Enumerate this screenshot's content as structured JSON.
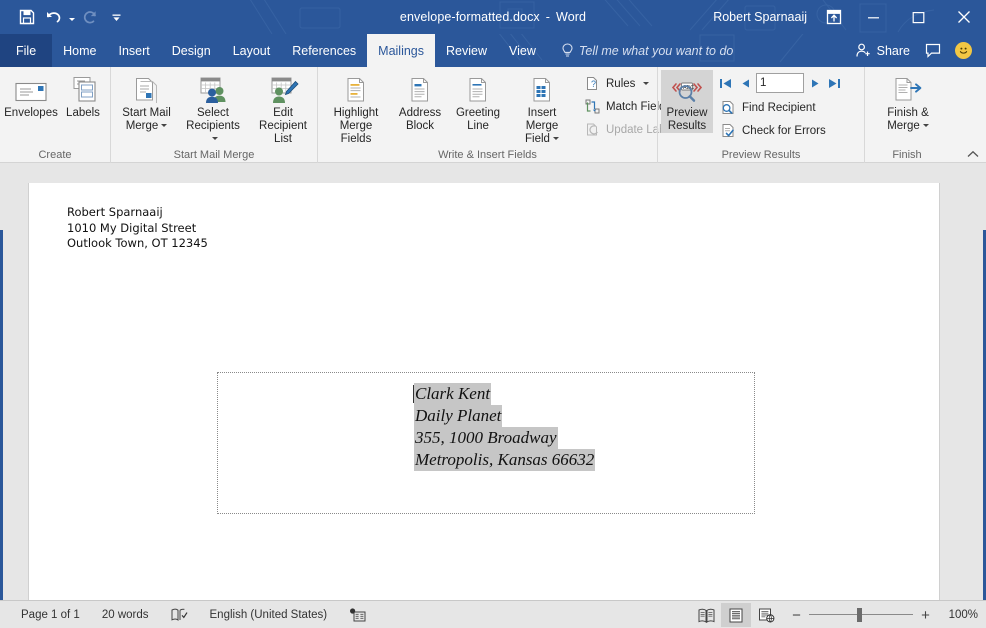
{
  "window": {
    "title": "envelope-formatted.docx",
    "title_separator": "-",
    "app_name": "Word",
    "account_name": "Robert Sparnaaij",
    "minimize_label": "Minimize",
    "maximize_label": "Maximize",
    "close_label": "Close",
    "ribbon_display_label": "Ribbon Display Options",
    "accent_color": "#2b579a"
  },
  "quick_access": [
    {
      "name": "save",
      "label": "Save"
    },
    {
      "name": "undo",
      "label": "Undo"
    },
    {
      "name": "redo",
      "label": "Repeat"
    },
    {
      "name": "customize",
      "label": "Customize Quick Access Toolbar"
    }
  ],
  "tabs": [
    {
      "label": "File",
      "active": false
    },
    {
      "label": "Home",
      "active": false
    },
    {
      "label": "Insert",
      "active": false
    },
    {
      "label": "Design",
      "active": false
    },
    {
      "label": "Layout",
      "active": false
    },
    {
      "label": "References",
      "active": false
    },
    {
      "label": "Mailings",
      "active": true
    },
    {
      "label": "Review",
      "active": false
    },
    {
      "label": "View",
      "active": false
    }
  ],
  "tellme": {
    "placeholder": "Tell me what you want to do"
  },
  "share": {
    "label": "Share"
  },
  "comments": {
    "label": "Comments"
  },
  "ribbon": {
    "groups": [
      {
        "label": "Create",
        "buttons": [
          {
            "label": "Envelopes",
            "icon": "envelope-icon",
            "dropdown": false
          },
          {
            "label": "Labels",
            "icon": "labels-icon",
            "dropdown": false
          }
        ]
      },
      {
        "label": "Start Mail Merge",
        "buttons": [
          {
            "label_line1": "Start Mail",
            "label_line2": "Merge",
            "icon": "start-mail-merge-icon",
            "dropdown": true
          },
          {
            "label_line1": "Select",
            "label_line2": "Recipients",
            "icon": "select-recipients-icon",
            "dropdown": true
          },
          {
            "label_line1": "Edit",
            "label_line2": "Recipient List",
            "icon": "edit-recipient-list-icon",
            "dropdown": false
          }
        ]
      },
      {
        "label": "Write & Insert Fields",
        "buttons": [
          {
            "label_line1": "Highlight",
            "label_line2": "Merge Fields",
            "icon": "highlight-merge-fields-icon",
            "dropdown": false
          },
          {
            "label_line1": "Address",
            "label_line2": "Block",
            "icon": "address-block-icon",
            "dropdown": false
          },
          {
            "label_line1": "Greeting",
            "label_line2": "Line",
            "icon": "greeting-line-icon",
            "dropdown": false
          },
          {
            "label_line1": "Insert Merge",
            "label_line2": "Field",
            "icon": "insert-merge-field-icon",
            "dropdown": true
          }
        ],
        "small_buttons": [
          {
            "label": "Rules",
            "icon": "rules-icon",
            "dropdown": true,
            "disabled": false
          },
          {
            "label": "Match Fields",
            "icon": "match-fields-icon",
            "dropdown": false,
            "disabled": false
          },
          {
            "label": "Update Labels",
            "icon": "update-labels-icon",
            "dropdown": false,
            "disabled": true
          }
        ]
      },
      {
        "label": "Preview Results",
        "toggle_button": {
          "label_line1": "Preview",
          "label_line2": "Results",
          "icon": "preview-results-icon",
          "toggled": true
        },
        "record_nav": {
          "first_label": "First Record",
          "prev_label": "Previous Record",
          "value": "1",
          "next_label": "Next Record",
          "last_label": "Last Record"
        },
        "small_buttons": [
          {
            "label": "Find Recipient",
            "icon": "find-recipient-icon",
            "disabled": false
          },
          {
            "label": "Check for Errors",
            "icon": "check-for-errors-icon",
            "disabled": false
          }
        ]
      },
      {
        "label": "Finish",
        "buttons": [
          {
            "label_line1": "Finish &",
            "label_line2": "Merge",
            "icon": "finish-and-merge-icon",
            "dropdown": true
          }
        ]
      }
    ],
    "collapse_label": "Collapse the Ribbon"
  },
  "document": {
    "return_address": "Robert Sparnaaij\n1010 My Digital Street\nOutlook Town, OT 12345",
    "envelope_address_lines": [
      "Clark Kent",
      "Daily Planet",
      "355, 1000 Broadway",
      "Metropolis, Kansas 66632"
    ],
    "field_shading_color": "#c6c6c6"
  },
  "statusbar": {
    "page": "Page 1 of 1",
    "words": "20 words",
    "proofing_label": "Proofing errors",
    "language": "English (United States)",
    "macro_label": "Macro Recording",
    "views": [
      {
        "name": "read-mode",
        "label": "Read Mode",
        "active": false
      },
      {
        "name": "print-layout",
        "label": "Print Layout",
        "active": true
      },
      {
        "name": "web-layout",
        "label": "Web Layout",
        "active": false
      }
    ],
    "zoom_out_label": "Zoom Out",
    "zoom_in_label": "Zoom In",
    "zoom_level": "100%"
  }
}
